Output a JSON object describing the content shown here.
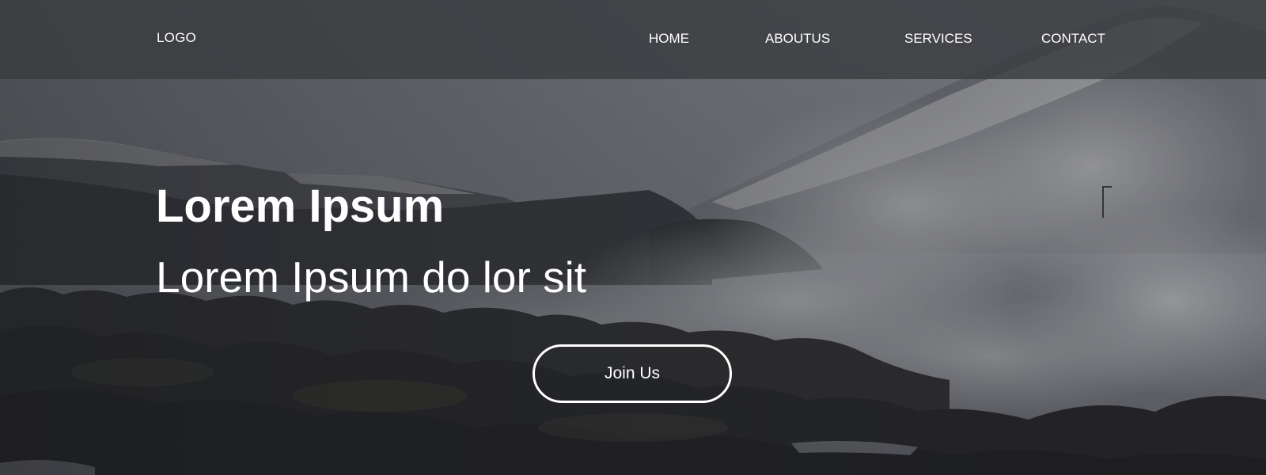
{
  "nav": {
    "logo": "LOGO",
    "links": [
      {
        "label": "HOME"
      },
      {
        "label": "ABOUTUS"
      },
      {
        "label": "SERVICES"
      },
      {
        "label": "CONTACT"
      }
    ]
  },
  "hero": {
    "title": "Lorem Ipsum",
    "subtitle": "Lorem Ipsum do lor sit",
    "cta_label": "Join Us",
    "background_image": "volcanic-landscape-with-steam"
  },
  "colors": {
    "nav_background": "#3a3c3f",
    "text": "#ffffff",
    "overlay": "#2c2e31"
  }
}
